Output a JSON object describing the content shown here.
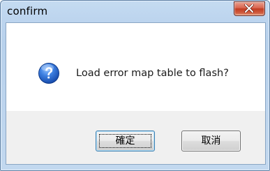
{
  "window": {
    "title": "confirm"
  },
  "titlebar": {
    "close_icon": "close-icon"
  },
  "dialog": {
    "icon": "question-icon",
    "message": "Load error map table to flash?"
  },
  "buttons": {
    "ok_label": "確定",
    "cancel_label": "取消"
  },
  "colors": {
    "close_button": "#c13d22",
    "question_icon": "#1e5bc6",
    "focus_border": "#3c7fb1"
  }
}
